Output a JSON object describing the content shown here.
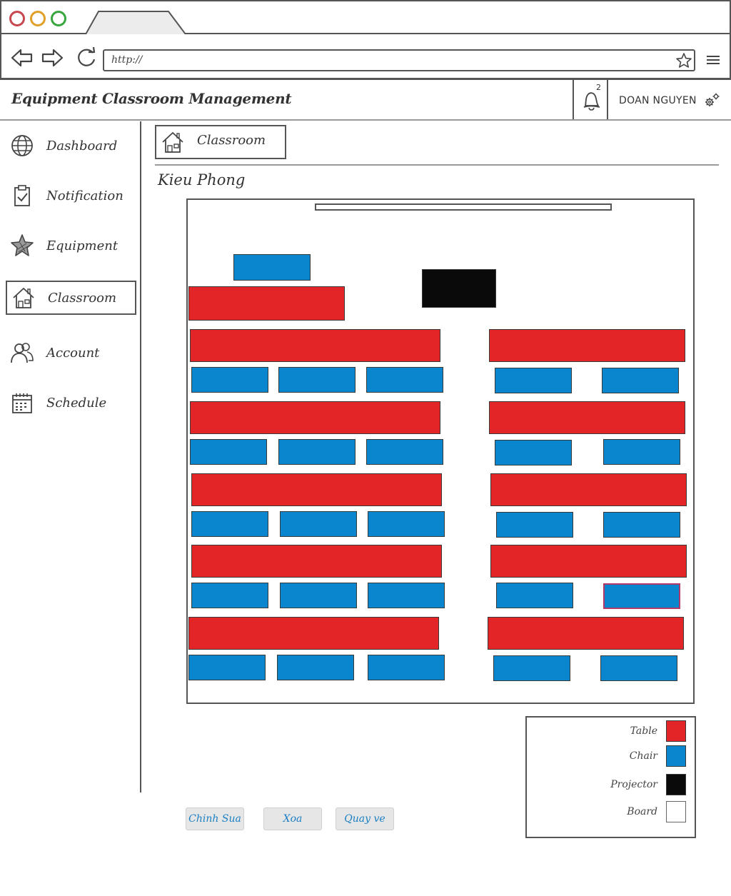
{
  "browser": {
    "url": "http://"
  },
  "app": {
    "title": "Equipment Classroom Management",
    "notification_count": "2",
    "user_name": "DOAN NGUYEN"
  },
  "sidebar": {
    "items": [
      {
        "label": "Dashboard",
        "icon": "globe-icon"
      },
      {
        "label": "Notification",
        "icon": "clipboard-check-icon"
      },
      {
        "label": "Equipment",
        "icon": "star-icon"
      },
      {
        "label": "Classroom",
        "icon": "house-icon",
        "active": true
      },
      {
        "label": "Account",
        "icon": "users-icon"
      },
      {
        "label": "Schedule",
        "icon": "calendar-icon"
      }
    ]
  },
  "main": {
    "breadcrumb": "Classroom",
    "room_name": "Kieu Phong"
  },
  "legend": {
    "items": [
      {
        "label": "Table",
        "color": "#e42528"
      },
      {
        "label": "Chair",
        "color": "#0a86cf"
      },
      {
        "label": "Projector",
        "color": "#0a0a0a"
      },
      {
        "label": "Board",
        "color": "#ffffff"
      }
    ]
  },
  "actions": {
    "edit": "Chinh Sua",
    "delete": "Xoa",
    "back": "Quay ve"
  },
  "colors": {
    "table": "#e42528",
    "chair": "#0a86cf",
    "projector": "#0a0a0a",
    "board": "#ffffff"
  }
}
